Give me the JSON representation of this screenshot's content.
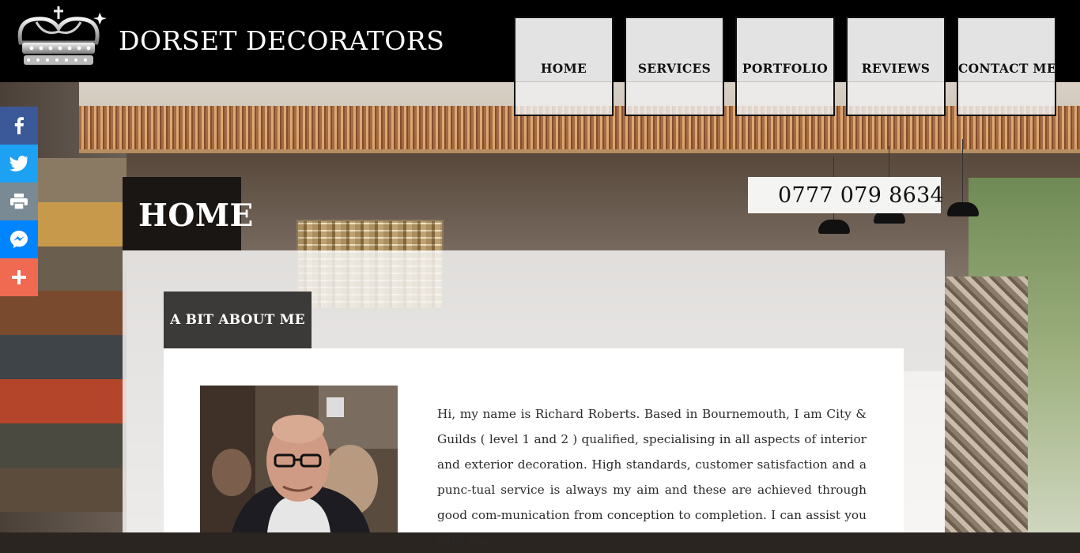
{
  "header": {
    "brand": "DORSET DECORATORS",
    "logo_icon": "crown-logo-icon"
  },
  "nav": {
    "items": [
      {
        "label": "HOME"
      },
      {
        "label": "SERVICES"
      },
      {
        "label": "PORTFOLIO"
      },
      {
        "label": "REVIEWS"
      },
      {
        "label": "CONTACT ME"
      }
    ]
  },
  "social": {
    "buttons": [
      {
        "icon": "facebook-icon",
        "color": "#3b5998"
      },
      {
        "icon": "twitter-icon",
        "color": "#1da1f2"
      },
      {
        "icon": "print-icon",
        "color": "#7a8a94"
      },
      {
        "icon": "messenger-icon",
        "color": "#0084ff"
      },
      {
        "icon": "share-more-icon",
        "color": "#f06a52"
      }
    ]
  },
  "page": {
    "title": "HOME",
    "phone": "0777 079 8634",
    "section_title": "A BIT ABOUT ME",
    "about_text": "Hi, my name is Richard Roberts. Based in Bournemouth, I am City & Guilds ( level 1 and 2 ) qualified, specialising in all aspects of interior and exterior decoration. High standards, customer satisfaction and a punc-tual service is always my aim and these are achieved through good com-munication from conception to completion. I can assist you with any"
  }
}
